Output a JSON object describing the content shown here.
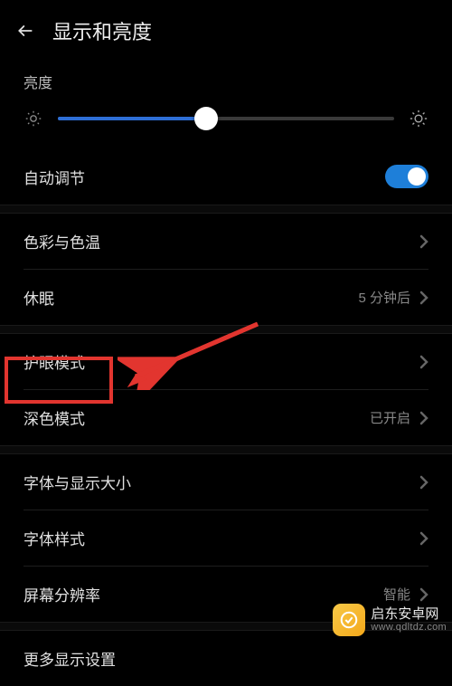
{
  "header": {
    "title": "显示和亮度"
  },
  "brightness": {
    "section_label": "亮度",
    "percent": 44,
    "auto_label": "自动调节",
    "auto_on": true
  },
  "rows": {
    "color_temp": {
      "label": "色彩与色温",
      "value": ""
    },
    "sleep": {
      "label": "休眠",
      "value": "5 分钟后"
    },
    "eye_comfort": {
      "label": "护眼模式",
      "value": ""
    },
    "dark_mode": {
      "label": "深色模式",
      "value": "已开启"
    },
    "font_size": {
      "label": "字体与显示大小",
      "value": ""
    },
    "font_style": {
      "label": "字体样式",
      "value": ""
    },
    "resolution": {
      "label": "屏幕分辨率",
      "value": "智能"
    },
    "more": {
      "label": "更多显示设置",
      "value": ""
    }
  },
  "watermark": {
    "name": "启东安卓网",
    "url": "www.qdltdz.com"
  },
  "annotation": {
    "highlight_target": "dark_mode"
  }
}
